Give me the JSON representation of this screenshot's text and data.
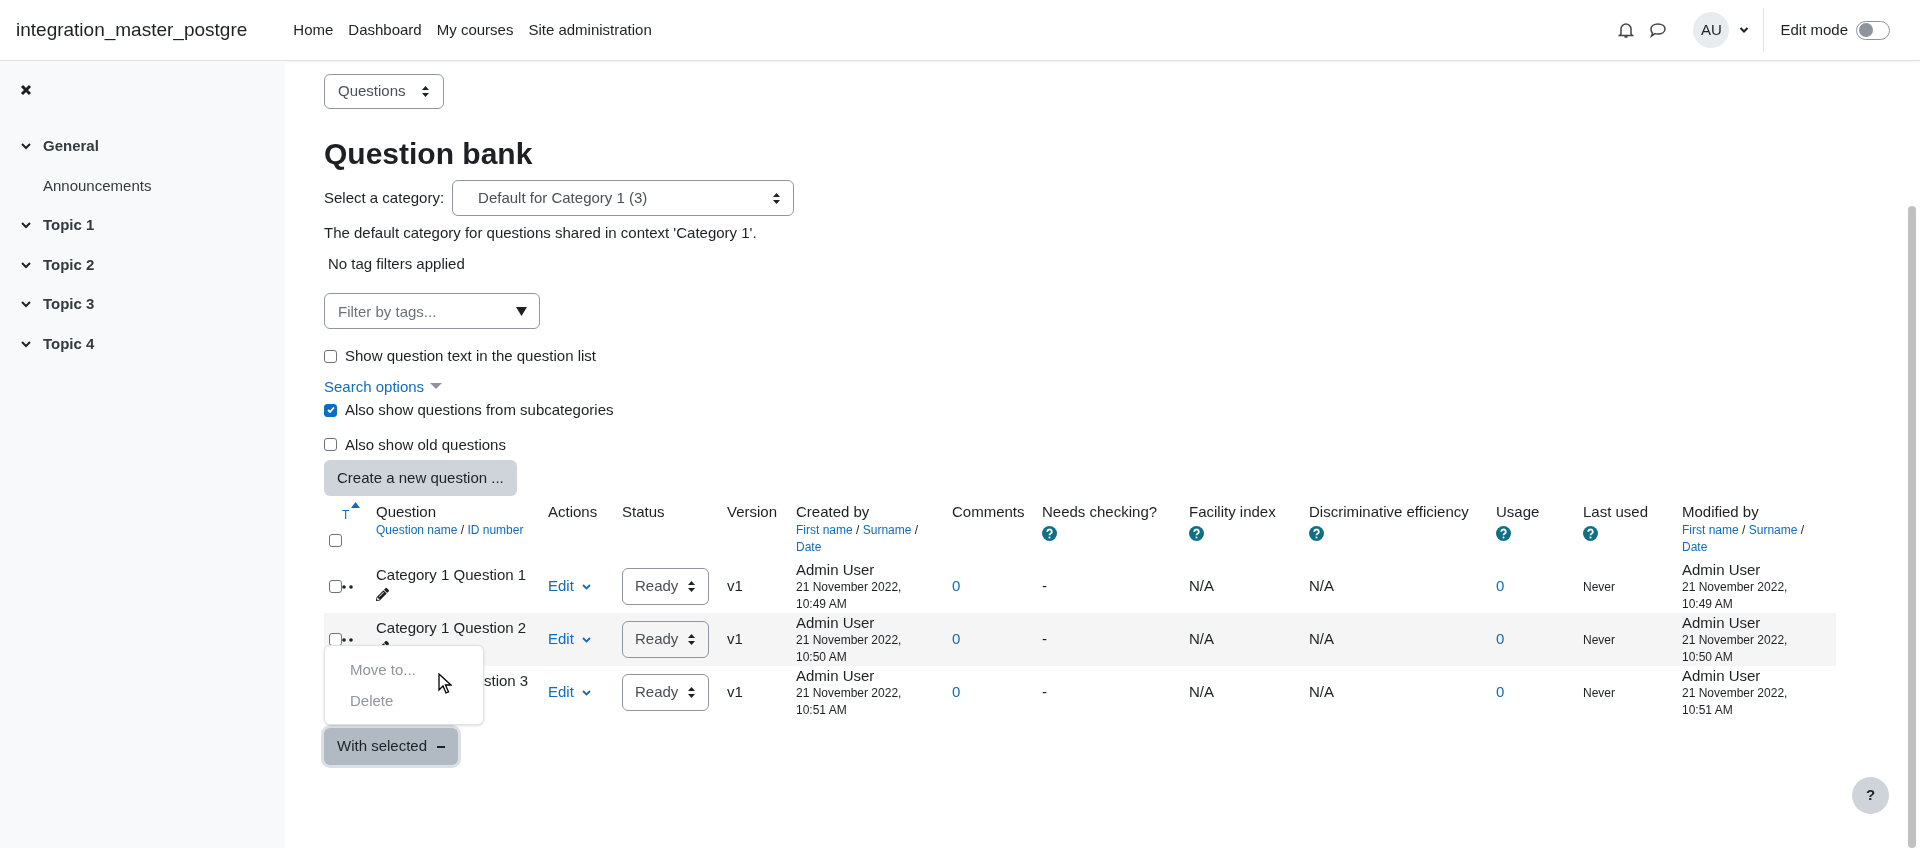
{
  "header": {
    "site_name": "integration_master_postgre",
    "nav": [
      {
        "label": "Home"
      },
      {
        "label": "Dashboard"
      },
      {
        "label": "My courses"
      },
      {
        "label": "Site administration"
      }
    ],
    "avatar": "AU",
    "edit_mode": {
      "label": "Edit mode",
      "on": false
    }
  },
  "sidebar": {
    "sections": [
      {
        "title": "General",
        "expanded": true,
        "children": [
          {
            "label": "Announcements"
          }
        ]
      },
      {
        "title": "Topic 1",
        "expanded": true
      },
      {
        "title": "Topic 2",
        "expanded": true
      },
      {
        "title": "Topic 3",
        "expanded": true
      },
      {
        "title": "Topic 4",
        "expanded": true
      }
    ]
  },
  "view_select": "Questions",
  "heading": "Question bank",
  "category": {
    "label": "Select a category:",
    "value": "Default for Category 1 (3)",
    "description": "The default category for questions shared in context 'Category 1'."
  },
  "tag_status": "No tag filters applied",
  "tag_filter": {
    "placeholder": "Filter by tags..."
  },
  "show_text": {
    "label": "Show question text in the question list",
    "checked": false
  },
  "search_options": "Search options",
  "options": [
    {
      "label": "Also show questions from subcategories",
      "checked": true
    },
    {
      "label": "Also show old questions",
      "checked": false
    }
  ],
  "create_button": "Create a new question ...",
  "table": {
    "type_sort": {
      "label": "T",
      "ascending": true
    },
    "select_all": {
      "checked": false
    },
    "separator": "/",
    "columns": [
      {
        "label": "Question",
        "sort_links": [
          "Question name",
          "ID number"
        ],
        "help": false
      },
      {
        "label": "Actions",
        "help": false
      },
      {
        "label": "Status",
        "help": false
      },
      {
        "label": "Version",
        "help": false
      },
      {
        "label": "Created by",
        "sort_links": [
          "First name",
          "Surname",
          "Date"
        ],
        "help": false
      },
      {
        "label": "Comments",
        "help": false
      },
      {
        "label": "Needs checking?",
        "help": true
      },
      {
        "label": "Facility index",
        "help": true
      },
      {
        "label": "Discriminative efficiency",
        "help": true
      },
      {
        "label": "Usage",
        "help": true
      },
      {
        "label": "Last used",
        "help": true
      },
      {
        "label": "Modified by",
        "sort_links": [
          "First name",
          "Surname",
          "Date"
        ],
        "help": false
      }
    ],
    "rows": [
      {
        "checked": false,
        "covered": false,
        "name": "Category 1 Question 1",
        "action": "Edit",
        "status": "Ready",
        "version": "v1",
        "created_name": "Admin User",
        "created_date": "21 November 2022, 10:49 AM",
        "comments": "0",
        "needs_checking": "-",
        "facility": "N/A",
        "discrimination": "N/A",
        "usage": "0",
        "last_used": "Never",
        "modified_name": "Admin User",
        "modified_date": "21 November 2022, 10:49 AM"
      },
      {
        "checked": false,
        "covered": false,
        "name": "Category 1 Question 2",
        "action": "Edit",
        "status": "Ready",
        "version": "v1",
        "created_name": "Admin User",
        "created_date": "21 November 2022, 10:50 AM",
        "comments": "0",
        "needs_checking": "-",
        "facility": "N/A",
        "discrimination": "N/A",
        "usage": "0",
        "last_used": "Never",
        "modified_name": "Admin User",
        "modified_date": "21 November 2022, 10:50 AM"
      },
      {
        "covered": true,
        "name": "stion 3",
        "action": "Edit",
        "status": "Ready",
        "version": "v1",
        "created_name": "Admin User",
        "created_date": "21 November 2022, 10:51 AM",
        "comments": "0",
        "needs_checking": "-",
        "facility": "N/A",
        "discrimination": "N/A",
        "usage": "0",
        "last_used": "Never",
        "modified_name": "Admin User",
        "modified_date": "21 November 2022, 10:51 AM"
      }
    ]
  },
  "bulk_menu": {
    "open": true,
    "items": [
      {
        "label": "Move to...",
        "disabled": true
      },
      {
        "label": "Delete",
        "disabled": true
      }
    ]
  },
  "bulk_button": "With selected",
  "help_button": "?"
}
